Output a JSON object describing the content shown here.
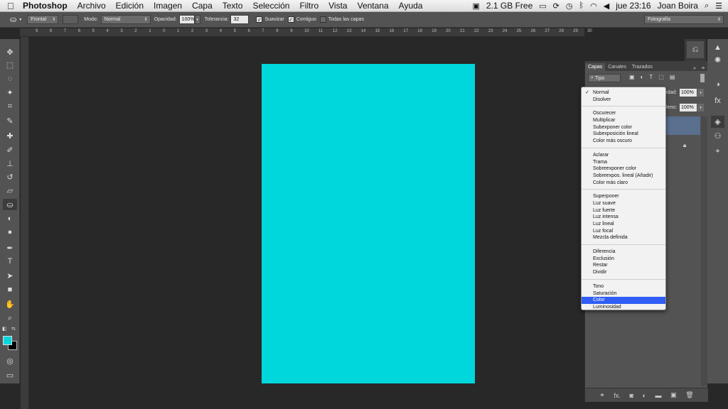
{
  "menubar": {
    "app_name": "Photoshop",
    "menus": [
      "Archivo",
      "Edición",
      "Imagen",
      "Capa",
      "Texto",
      "Selección",
      "Filtro",
      "Vista",
      "Ventana",
      "Ayuda"
    ],
    "memory": "2.1 GB Free",
    "clock": "jue 23:16",
    "user": "Joan Boira"
  },
  "options": {
    "fill_source": "Frontal",
    "mode_label": "Modo:",
    "mode_value": "Normal",
    "opacity_label": "Opacidad:",
    "opacity_value": "100%",
    "tolerance_label": "Tolerancia:",
    "tolerance_value": "32",
    "antialias_label": "Suavizar",
    "contiguous_label": "Contiguo",
    "all_layers_label": "Todas las capas",
    "workspace": "Fotografía"
  },
  "ruler": {
    "ticks": [
      "9",
      "8",
      "7",
      "6",
      "5",
      "4",
      "3",
      "2",
      "1",
      "0",
      "1",
      "2",
      "3",
      "4",
      "5",
      "6",
      "7",
      "8",
      "9",
      "10",
      "11",
      "12",
      "13",
      "14",
      "15",
      "16",
      "17",
      "18",
      "19",
      "20",
      "21",
      "22",
      "23",
      "24",
      "25",
      "26",
      "27",
      "28",
      "29",
      "30"
    ]
  },
  "document": {
    "fill_color": "#00d7dc"
  },
  "layers": {
    "tabs": [
      "Capas",
      "Canales",
      "Trazados"
    ],
    "filter_label": "Tipo",
    "opacity_label_fragment": "idad:",
    "opacity_value": "100%",
    "fill_label_fragment": "leno:",
    "fill_value": "100%"
  },
  "blend_menu": {
    "groups": [
      [
        "Normal",
        "Disolver"
      ],
      [
        "Oscurecer",
        "Multiplicar",
        "Subexponer color",
        "Subexposición lineal",
        "Color más oscuro"
      ],
      [
        "Aclarar",
        "Trama",
        "Sobreexponer color",
        "Sobreexpos. lineal (Añadir)",
        "Color más claro"
      ],
      [
        "Superponer",
        "Luz suave",
        "Luz fuerte",
        "Luz intensa",
        "Luz lineal",
        "Luz focal",
        "Mezcla definida"
      ],
      [
        "Diferencia",
        "Exclusión",
        "Restar",
        "Dividir"
      ],
      [
        "Tono",
        "Saturación",
        "Color",
        "Luminosidad"
      ]
    ],
    "checked": "Normal",
    "highlighted": "Color",
    "highlight_color": "#2f5df5"
  },
  "colors": {
    "foreground": "#00d7dc",
    "background": "#000000"
  }
}
